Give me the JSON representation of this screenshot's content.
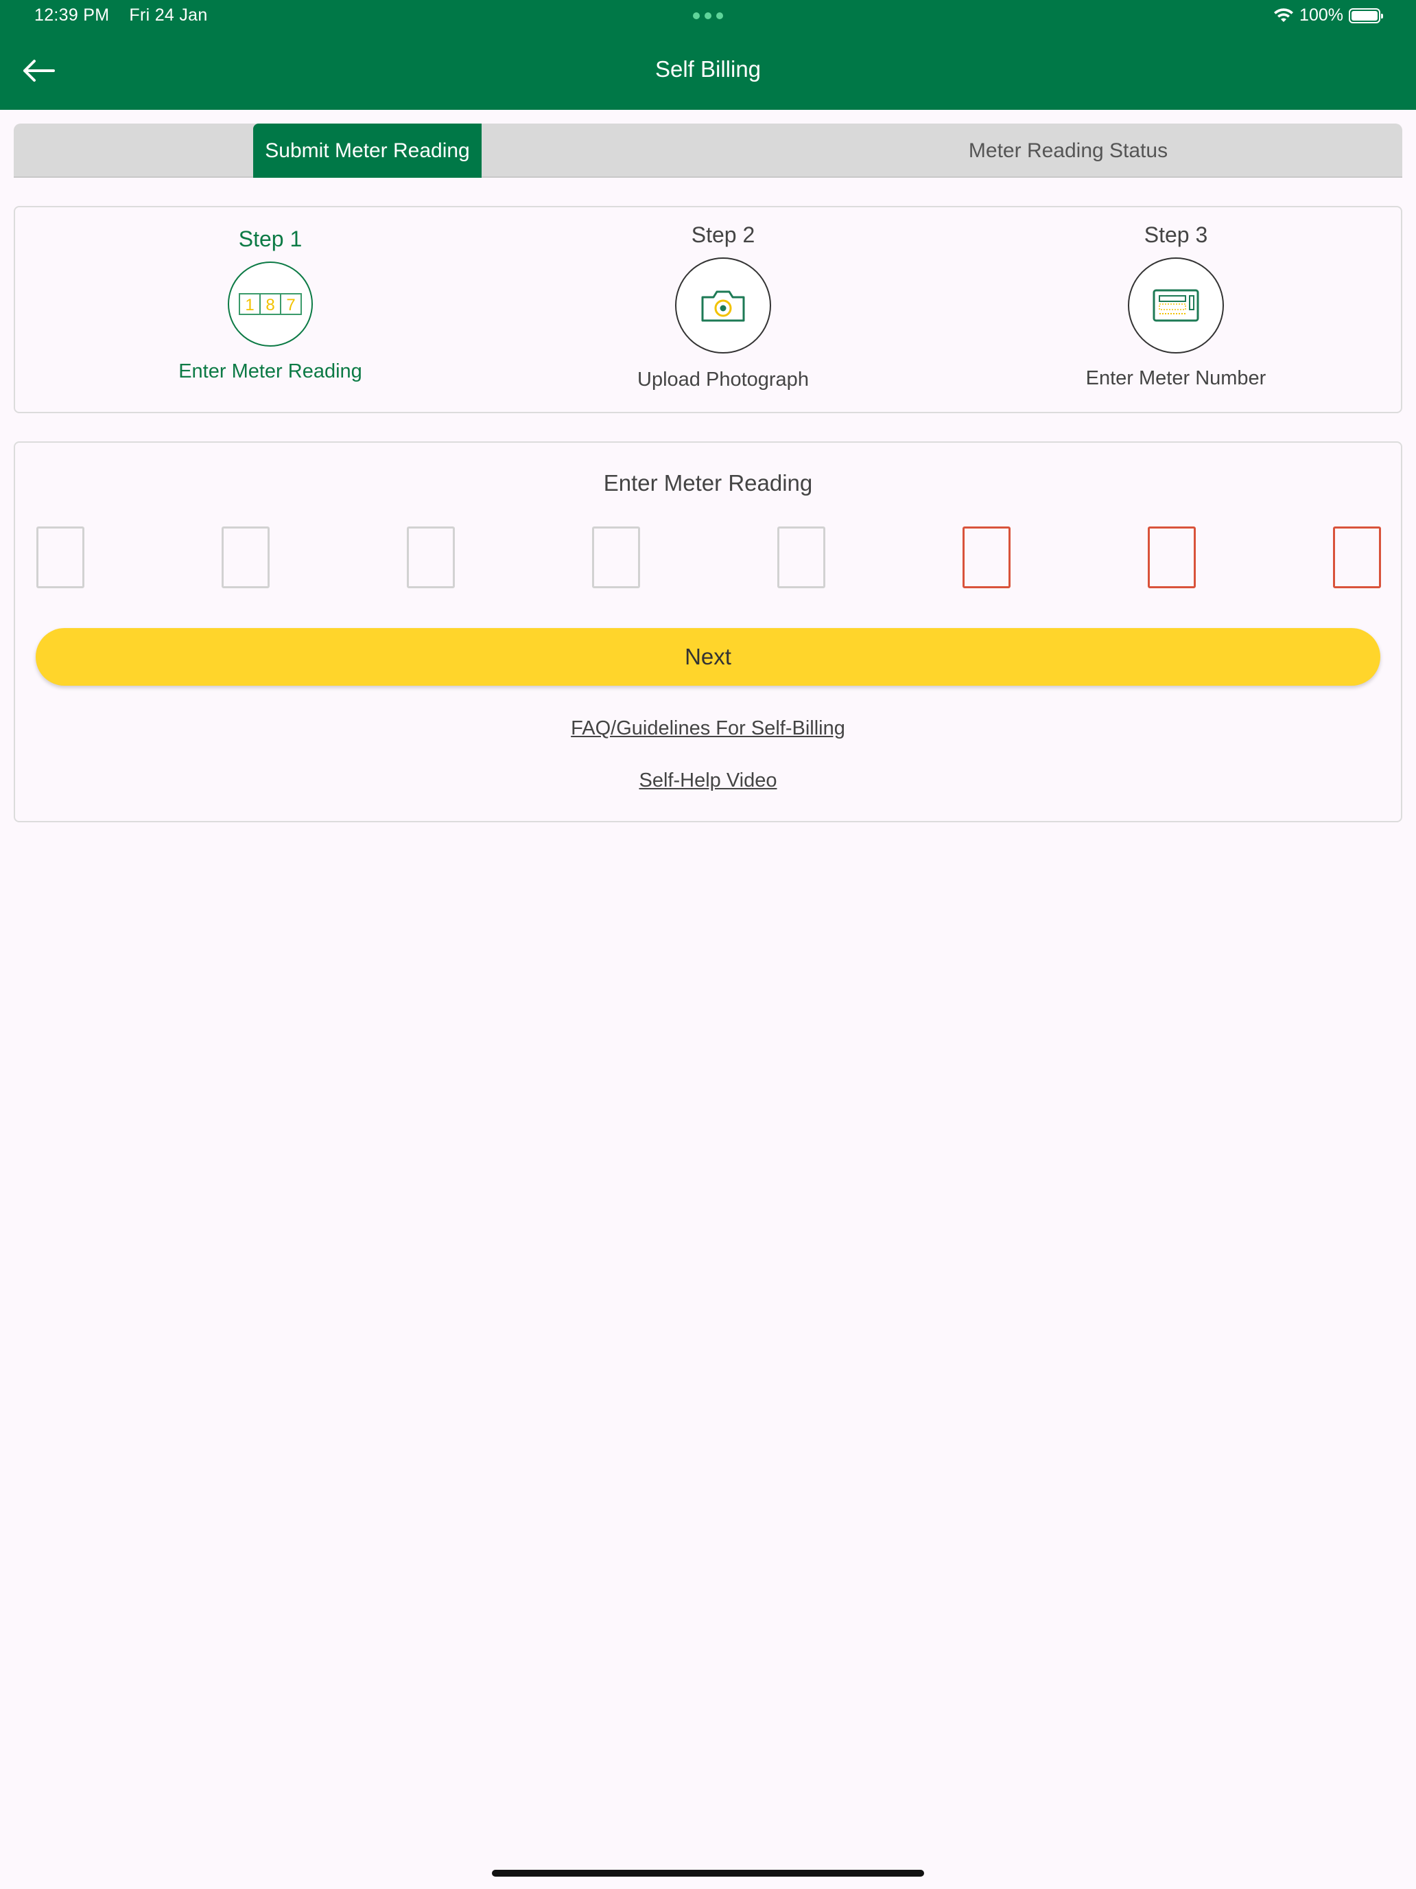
{
  "status_bar": {
    "time": "12:39 PM",
    "date": "Fri 24 Jan",
    "battery": "100%"
  },
  "header": {
    "title": "Self Billing",
    "back_icon": "arrow-left-icon"
  },
  "tabs": [
    {
      "label": "Submit Meter Reading",
      "active": true
    },
    {
      "label": "Meter Reading Status",
      "active": false
    }
  ],
  "steps": [
    {
      "title": "Step 1",
      "label": "Enter Meter Reading",
      "icon": "meter-digits-icon",
      "icon_digits": [
        "1",
        "8",
        "7"
      ],
      "active": true
    },
    {
      "title": "Step 2",
      "label": "Upload Photograph",
      "icon": "camera-icon",
      "active": false
    },
    {
      "title": "Step 3",
      "label": "Enter Meter Number",
      "icon": "meter-device-icon",
      "active": false
    }
  ],
  "reading": {
    "heading": "Enter Meter Reading",
    "digit_count": 8,
    "required_digits": [
      6,
      7,
      8
    ],
    "next_label": "Next",
    "faq_link": "FAQ/Guidelines For Self-Billing",
    "video_link": "Self-Help Video"
  },
  "colors": {
    "primary_green": "#007847",
    "button_yellow": "#FFD52B",
    "error_red": "#D9533B"
  }
}
